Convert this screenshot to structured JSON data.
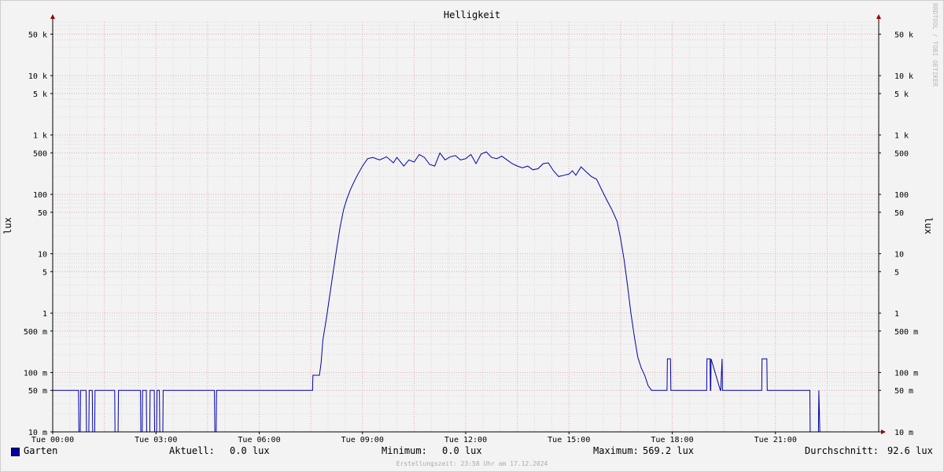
{
  "chart_data": {
    "type": "line",
    "title": "Helligkeit",
    "ylabel": "lux",
    "y_scale": "log",
    "ylim": [
      0.01,
      80000
    ],
    "xlim": [
      "00:00",
      "24:00"
    ],
    "x_tick_labels": [
      "Tue 00:00",
      "Tue 03:00",
      "Tue 06:00",
      "Tue 09:00",
      "Tue 12:00",
      "Tue 15:00",
      "Tue 18:00",
      "Tue 21:00"
    ],
    "x_tick_hours": [
      0,
      3,
      6,
      9,
      12,
      15,
      18,
      21
    ],
    "y_ticks": [
      {
        "value": 0.01,
        "label": "10 m"
      },
      {
        "value": 0.05,
        "label": "50 m"
      },
      {
        "value": 0.1,
        "label": "100 m"
      },
      {
        "value": 0.5,
        "label": "500 m"
      },
      {
        "value": 1,
        "label": "1"
      },
      {
        "value": 5,
        "label": "5"
      },
      {
        "value": 10,
        "label": "10"
      },
      {
        "value": 50,
        "label": "50"
      },
      {
        "value": 100,
        "label": "100"
      },
      {
        "value": 500,
        "label": "500"
      },
      {
        "value": 1000,
        "label": "1 k"
      },
      {
        "value": 5000,
        "label": "5 k"
      },
      {
        "value": 10000,
        "label": "10 k"
      },
      {
        "value": 50000,
        "label": "50 k"
      }
    ],
    "grid": true,
    "colors": {
      "series": "#0000aa",
      "major_grid": "#e8a8a8",
      "minor_grid": "#d8d8d8",
      "axis": "#000000",
      "arrow": "#990000"
    },
    "series": [
      {
        "name": "Garten",
        "x_hours": [
          0,
          0.75,
          0.76,
          0.8,
          0.81,
          0.97,
          0.98,
          1.05,
          1.06,
          1.15,
          1.16,
          1.22,
          1.23,
          1.25,
          1.26,
          1.8,
          1.81,
          1.9,
          1.91,
          2.55,
          2.56,
          2.6,
          2.61,
          2.72,
          2.73,
          2.82,
          2.83,
          2.95,
          2.96,
          3.02,
          3.03,
          3.1,
          3.11,
          3.2,
          3.21,
          3.35,
          3.36,
          4.7,
          4.71,
          4.75,
          4.76,
          7.55,
          7.56,
          7.75,
          7.8,
          7.85,
          7.95,
          8.05,
          8.15,
          8.25,
          8.35,
          8.45,
          8.55,
          8.65,
          8.75,
          8.85,
          9.0,
          9.15,
          9.3,
          9.5,
          9.7,
          9.9,
          10.0,
          10.2,
          10.35,
          10.5,
          10.65,
          10.8,
          10.95,
          11.1,
          11.25,
          11.4,
          11.55,
          11.7,
          11.85,
          12.0,
          12.15,
          12.3,
          12.45,
          12.6,
          12.75,
          12.9,
          13.05,
          13.2,
          13.35,
          13.5,
          13.65,
          13.8,
          13.95,
          14.1,
          14.25,
          14.4,
          14.55,
          14.7,
          14.85,
          15.0,
          15.1,
          15.2,
          15.35,
          15.5,
          15.65,
          15.8,
          15.95,
          16.1,
          16.25,
          16.4,
          16.5,
          16.6,
          16.7,
          16.8,
          16.9,
          17.0,
          17.1,
          17.2,
          17.3,
          17.4,
          17.5,
          17.6,
          17.62,
          17.85,
          17.86,
          17.95,
          17.96,
          19.0,
          19.01,
          19.1,
          19.11,
          19.12,
          19.13,
          19.4,
          19.41,
          19.45,
          19.46,
          20.6,
          20.61,
          20.75,
          20.76,
          22.0,
          22.01,
          22.25,
          22.26,
          22.29,
          22.3,
          24
        ],
        "y_lux": [
          0.05,
          0.05,
          0.01,
          0.01,
          0.05,
          0.05,
          0.01,
          0.01,
          0.05,
          0.05,
          0.01,
          0.01,
          0.05,
          0.05,
          0.05,
          0.05,
          0.01,
          0.01,
          0.05,
          0.05,
          0.01,
          0.01,
          0.05,
          0.05,
          0.01,
          0.01,
          0.05,
          0.05,
          0.01,
          0.01,
          0.05,
          0.05,
          0.01,
          0.01,
          0.05,
          0.05,
          0.05,
          0.05,
          0.01,
          0.01,
          0.05,
          0.05,
          0.09,
          0.09,
          0.15,
          0.35,
          0.8,
          2,
          5,
          12,
          28,
          55,
          85,
          120,
          160,
          210,
          300,
          400,
          420,
          380,
          430,
          340,
          420,
          300,
          380,
          350,
          470,
          420,
          320,
          300,
          500,
          380,
          430,
          450,
          380,
          400,
          470,
          330,
          480,
          520,
          420,
          400,
          440,
          380,
          330,
          300,
          280,
          300,
          260,
          270,
          330,
          340,
          250,
          200,
          210,
          220,
          250,
          210,
          290,
          240,
          200,
          180,
          120,
          80,
          55,
          35,
          18,
          8,
          3,
          1,
          0.4,
          0.18,
          0.12,
          0.09,
          0.06,
          0.05,
          0.05,
          0.05,
          0.05,
          0.05,
          0.17,
          0.17,
          0.05,
          0.05,
          0.17,
          0.17,
          0.05,
          0.05,
          0.17,
          0.05,
          0.05,
          0.17,
          0.05,
          0.05,
          0.17,
          0.17,
          0.05,
          0.05,
          0.01,
          0.01,
          0.05,
          0.01,
          0.01,
          0.01
        ],
        "aktuell_label": "Aktuell:",
        "aktuell": "0.0 lux",
        "minimum_label": "Minimum:",
        "minimum": "0.0 lux",
        "maximum_label": "Maximum:",
        "maximum": "569.2 lux",
        "durchschnitt_label": "Durchschnitt:",
        "durchschnitt": "92.6 lux"
      }
    ]
  },
  "footer": {
    "generated": "Erstellungszeit: 23:58 Uhr am 17.12.2024",
    "watermark": "RRDTOOL / TOBI OETIKER"
  }
}
